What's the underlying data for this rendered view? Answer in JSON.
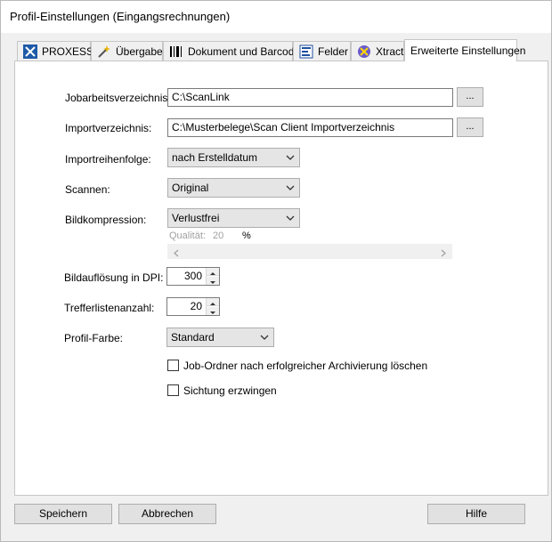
{
  "window": {
    "title": "Profil-Einstellungen (Eingangsrechnungen)"
  },
  "tabs": [
    {
      "label": "PROXESS",
      "icon": "proxess-logo-icon",
      "active": false
    },
    {
      "label": "Übergabe",
      "icon": "magic-wand-icon",
      "active": false
    },
    {
      "label": "Dokument und Barcode",
      "icon": "barcode-icon",
      "active": false
    },
    {
      "label": "Felder",
      "icon": "fields-form-icon",
      "active": false
    },
    {
      "label": "Xtract",
      "icon": "xtract-icon",
      "active": false
    },
    {
      "label": "Erweiterte Einstellungen",
      "icon": "",
      "active": true
    }
  ],
  "form": {
    "jobdir": {
      "label": "Jobarbeitsverzeichnis:",
      "value": "C:\\ScanLink",
      "browse": "..."
    },
    "importdir": {
      "label": "Importverzeichnis:",
      "value": "C:\\Musterbelege\\Scan Client Importverzeichnis",
      "browse": "..."
    },
    "importorder": {
      "label": "Importreihenfolge:",
      "value": "nach Erstelldatum"
    },
    "scan": {
      "label": "Scannen:",
      "value": "Original"
    },
    "compression": {
      "label": "Bildkompression:",
      "value": "Verlustfrei"
    },
    "quality": {
      "label": "Qualität:",
      "value": "20",
      "unit": "%"
    },
    "dpi": {
      "label": "Bildauflösung in DPI:",
      "value": "300"
    },
    "hits": {
      "label": "Trefferlistenanzahl:",
      "value": "20"
    },
    "color": {
      "label": "Profil-Farbe:",
      "value": "Standard"
    },
    "delete_job": {
      "label": "Job-Ordner nach erfolgreicher Archivierung löschen",
      "checked": false
    },
    "force_view": {
      "label": "Sichtung erzwingen",
      "checked": false
    }
  },
  "buttons": {
    "save": "Speichern",
    "cancel": "Abbrechen",
    "help": "Hilfe"
  }
}
